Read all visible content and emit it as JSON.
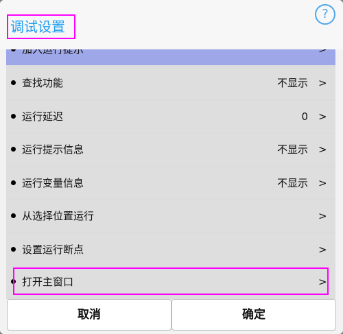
{
  "dialog": {
    "title": "调试设置",
    "help_glyph": "?"
  },
  "settings": [
    {
      "label": "加入运行提示",
      "value": "",
      "chevron": ">"
    },
    {
      "label": "查找功能",
      "value": "不显示",
      "chevron": ">"
    },
    {
      "label": "运行延迟",
      "value": "0",
      "chevron": ">"
    },
    {
      "label": "运行提示信息",
      "value": "不显示",
      "chevron": ">"
    },
    {
      "label": "运行变量信息",
      "value": "不显示",
      "chevron": ">"
    },
    {
      "label": "从选择位置运行",
      "value": "",
      "chevron": ">"
    },
    {
      "label": "设置运行断点",
      "value": "",
      "chevron": ">"
    },
    {
      "label": "打开主窗口",
      "value": "",
      "chevron": ">"
    }
  ],
  "buttons": {
    "cancel": "取消",
    "ok": "确定"
  },
  "colors": {
    "title": "#1e9cf0",
    "highlight": "#ff00ff",
    "first_row": "#9ea7e8"
  }
}
